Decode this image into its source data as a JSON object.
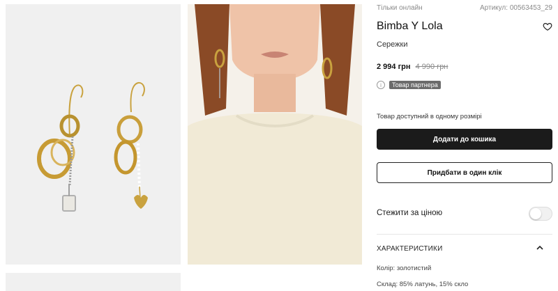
{
  "product": {
    "availability_note": "Тільки онлайн",
    "article": "Артикул: 00563453_29",
    "brand": "Bimba Y Lola",
    "category": "Сережки",
    "price_current": "2 994 грн",
    "price_old": "4 990 грн",
    "partner_badge": "Товар партнера",
    "size_note": "Товар доступний в одному розмірі"
  },
  "actions": {
    "add_to_cart": "Додати до кошика",
    "buy_one_click": "Придбати в один клік"
  },
  "price_watch": {
    "label": "Стежити за ціною",
    "enabled": false
  },
  "characteristics": {
    "title": "ХАРАКТЕРИСТИКИ",
    "expanded": true,
    "items": [
      "Колір: золотистий",
      "Склад: 85% латунь, 15% скло"
    ]
  },
  "colors": {
    "primary_button": "#1b1b1b",
    "badge": "#6b6b6b"
  }
}
